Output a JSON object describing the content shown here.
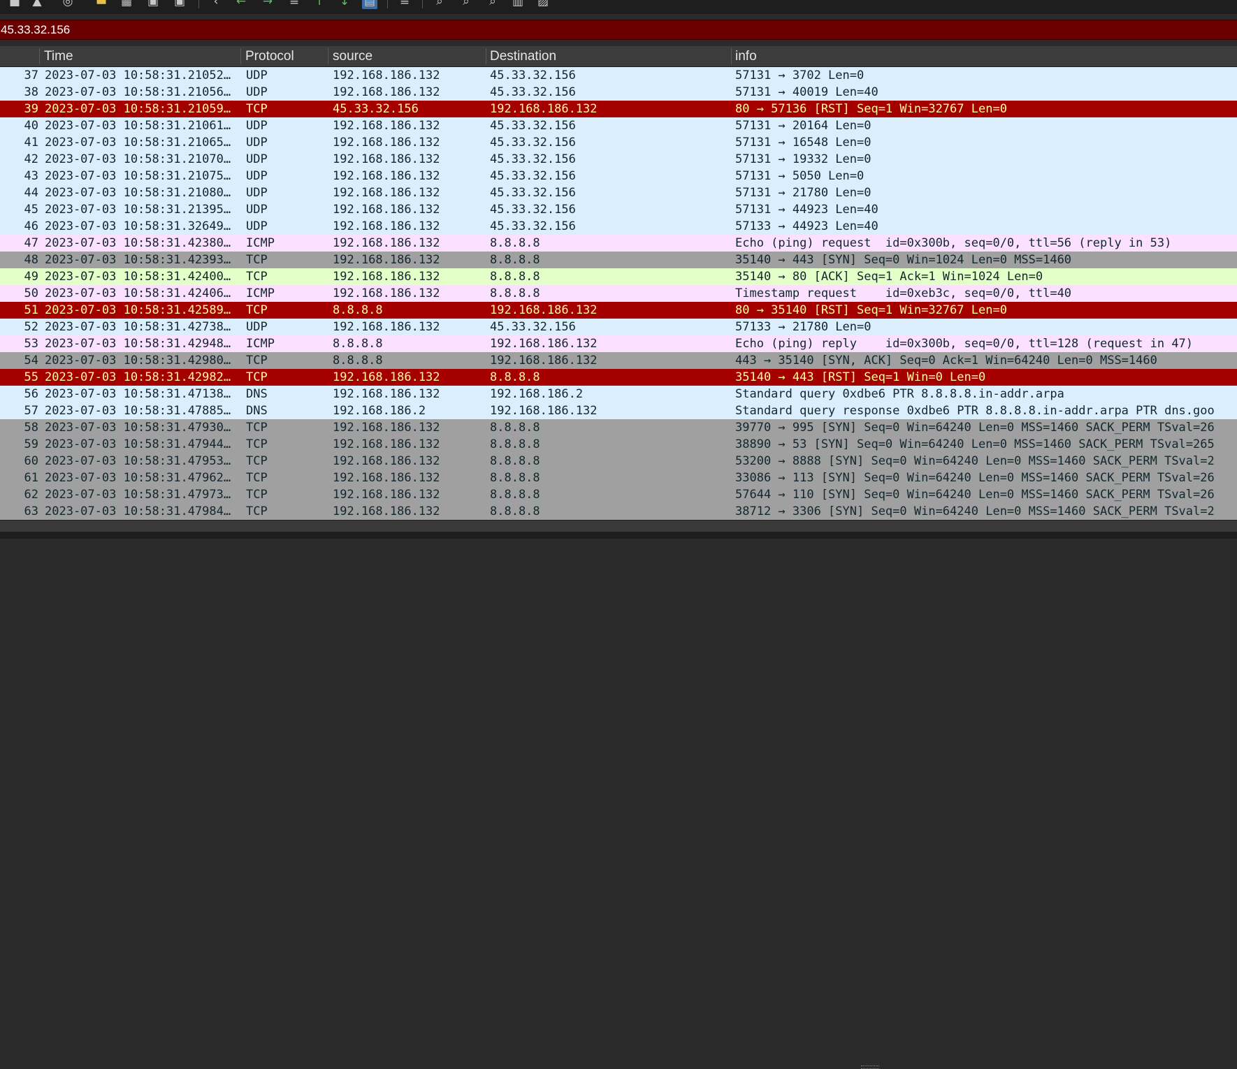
{
  "toolbar": {
    "icons": [
      "stop-icon",
      "restart-icon",
      "options-icon",
      "open-folder-icon",
      "save-file-icon",
      "close-file-icon",
      "reload-icon",
      "go-back-icon",
      "go-forward-icon",
      "go-to-packet-icon",
      "first-packet-icon",
      "last-packet-icon",
      "autoscroll-icon",
      "colorize-icon",
      "zoom-in-icon",
      "zoom-out-icon",
      "normal-size-icon",
      "resize-columns-icon",
      "expand-icon"
    ]
  },
  "filter": {
    "value": "45.33.32.156"
  },
  "columns": {
    "no": "",
    "time": "Time",
    "protocol": "Protocol",
    "source": "source",
    "destination": "Destination",
    "info": "info"
  },
  "colors": {
    "udp": "#daeefd",
    "icmp": "#fce0ff",
    "tcp_ack": "#e4ffc7",
    "tcp_syn": "#a0a0a0",
    "rst_bg": "#a40000",
    "rst_fg": "#fffc9c",
    "filter_bg": "#6b0000"
  },
  "packets": [
    {
      "no": "37",
      "time": "2023-07-03 10:58:31.21052…",
      "protocol": "UDP",
      "source": "192.168.186.132",
      "destination": "45.33.32.156",
      "info": "57131 → 3702 Len=0",
      "style": "udp"
    },
    {
      "no": "38",
      "time": "2023-07-03 10:58:31.21056…",
      "protocol": "UDP",
      "source": "192.168.186.132",
      "destination": "45.33.32.156",
      "info": "57131 → 40019 Len=40",
      "style": "udp"
    },
    {
      "no": "39",
      "time": "2023-07-03 10:58:31.21059…",
      "protocol": "TCP",
      "source": "45.33.32.156",
      "destination": "192.168.186.132",
      "info": "80 → 57136 [RST] Seq=1 Win=32767 Len=0",
      "style": "rst"
    },
    {
      "no": "40",
      "time": "2023-07-03 10:58:31.21061…",
      "protocol": "UDP",
      "source": "192.168.186.132",
      "destination": "45.33.32.156",
      "info": "57131 → 20164 Len=0",
      "style": "udp"
    },
    {
      "no": "41",
      "time": "2023-07-03 10:58:31.21065…",
      "protocol": "UDP",
      "source": "192.168.186.132",
      "destination": "45.33.32.156",
      "info": "57131 → 16548 Len=0",
      "style": "udp"
    },
    {
      "no": "42",
      "time": "2023-07-03 10:58:31.21070…",
      "protocol": "UDP",
      "source": "192.168.186.132",
      "destination": "45.33.32.156",
      "info": "57131 → 19332 Len=0",
      "style": "udp"
    },
    {
      "no": "43",
      "time": "2023-07-03 10:58:31.21075…",
      "protocol": "UDP",
      "source": "192.168.186.132",
      "destination": "45.33.32.156",
      "info": "57131 → 5050 Len=0",
      "style": "udp"
    },
    {
      "no": "44",
      "time": "2023-07-03 10:58:31.21080…",
      "protocol": "UDP",
      "source": "192.168.186.132",
      "destination": "45.33.32.156",
      "info": "57131 → 21780 Len=0",
      "style": "udp"
    },
    {
      "no": "45",
      "time": "2023-07-03 10:58:31.21395…",
      "protocol": "UDP",
      "source": "192.168.186.132",
      "destination": "45.33.32.156",
      "info": "57131 → 44923 Len=40",
      "style": "udp"
    },
    {
      "no": "46",
      "time": "2023-07-03 10:58:31.32649…",
      "protocol": "UDP",
      "source": "192.168.186.132",
      "destination": "45.33.32.156",
      "info": "57133 → 44923 Len=40",
      "style": "udp"
    },
    {
      "no": "47",
      "time": "2023-07-03 10:58:31.42380…",
      "protocol": "ICMP",
      "source": "192.168.186.132",
      "destination": "8.8.8.8",
      "info": "Echo (ping) request  id=0x300b, seq=0/0, ttl=56 (reply in 53)",
      "style": "icmp"
    },
    {
      "no": "48",
      "time": "2023-07-03 10:58:31.42393…",
      "protocol": "TCP",
      "source": "192.168.186.132",
      "destination": "8.8.8.8",
      "info": "35140 → 443 [SYN] Seq=0 Win=1024 Len=0 MSS=1460",
      "style": "tcp-syn"
    },
    {
      "no": "49",
      "time": "2023-07-03 10:58:31.42400…",
      "protocol": "TCP",
      "source": "192.168.186.132",
      "destination": "8.8.8.8",
      "info": "35140 → 80 [ACK] Seq=1 Ack=1 Win=1024 Len=0",
      "style": "tcp-ack"
    },
    {
      "no": "50",
      "time": "2023-07-03 10:58:31.42406…",
      "protocol": "ICMP",
      "source": "192.168.186.132",
      "destination": "8.8.8.8",
      "info": "Timestamp request    id=0xeb3c, seq=0/0, ttl=40",
      "style": "icmp"
    },
    {
      "no": "51",
      "time": "2023-07-03 10:58:31.42589…",
      "protocol": "TCP",
      "source": "8.8.8.8",
      "destination": "192.168.186.132",
      "info": "80 → 35140 [RST] Seq=1 Win=32767 Len=0",
      "style": "rst"
    },
    {
      "no": "52",
      "time": "2023-07-03 10:58:31.42738…",
      "protocol": "UDP",
      "source": "192.168.186.132",
      "destination": "45.33.32.156",
      "info": "57133 → 21780 Len=0",
      "style": "udp"
    },
    {
      "no": "53",
      "time": "2023-07-03 10:58:31.42948…",
      "protocol": "ICMP",
      "source": "8.8.8.8",
      "destination": "192.168.186.132",
      "info": "Echo (ping) reply    id=0x300b, seq=0/0, ttl=128 (request in 47)",
      "style": "icmp"
    },
    {
      "no": "54",
      "time": "2023-07-03 10:58:31.42980…",
      "protocol": "TCP",
      "source": "8.8.8.8",
      "destination": "192.168.186.132",
      "info": "443 → 35140 [SYN, ACK] Seq=0 Ack=1 Win=64240 Len=0 MSS=1460",
      "style": "tcp-syn"
    },
    {
      "no": "55",
      "time": "2023-07-03 10:58:31.42982…",
      "protocol": "TCP",
      "source": "192.168.186.132",
      "destination": "8.8.8.8",
      "info": "35140 → 443 [RST] Seq=1 Win=0 Len=0",
      "style": "rst"
    },
    {
      "no": "56",
      "time": "2023-07-03 10:58:31.47138…",
      "protocol": "DNS",
      "source": "192.168.186.132",
      "destination": "192.168.186.2",
      "info": "Standard query 0xdbe6 PTR 8.8.8.8.in-addr.arpa",
      "style": "dns"
    },
    {
      "no": "57",
      "time": "2023-07-03 10:58:31.47885…",
      "protocol": "DNS",
      "source": "192.168.186.2",
      "destination": "192.168.186.132",
      "info": "Standard query response 0xdbe6 PTR 8.8.8.8.in-addr.arpa PTR dns.goo",
      "style": "dns"
    },
    {
      "no": "58",
      "time": "2023-07-03 10:58:31.47930…",
      "protocol": "TCP",
      "source": "192.168.186.132",
      "destination": "8.8.8.8",
      "info": "39770 → 995 [SYN] Seq=0 Win=64240 Len=0 MSS=1460 SACK_PERM TSval=26",
      "style": "tcp-syn"
    },
    {
      "no": "59",
      "time": "2023-07-03 10:58:31.47944…",
      "protocol": "TCP",
      "source": "192.168.186.132",
      "destination": "8.8.8.8",
      "info": "38890 → 53 [SYN] Seq=0 Win=64240 Len=0 MSS=1460 SACK_PERM TSval=265",
      "style": "tcp-syn"
    },
    {
      "no": "60",
      "time": "2023-07-03 10:58:31.47953…",
      "protocol": "TCP",
      "source": "192.168.186.132",
      "destination": "8.8.8.8",
      "info": "53200 → 8888 [SYN] Seq=0 Win=64240 Len=0 MSS=1460 SACK_PERM TSval=2",
      "style": "tcp-syn"
    },
    {
      "no": "61",
      "time": "2023-07-03 10:58:31.47962…",
      "protocol": "TCP",
      "source": "192.168.186.132",
      "destination": "8.8.8.8",
      "info": "33086 → 113 [SYN] Seq=0 Win=64240 Len=0 MSS=1460 SACK_PERM TSval=26",
      "style": "tcp-syn"
    },
    {
      "no": "62",
      "time": "2023-07-03 10:58:31.47973…",
      "protocol": "TCP",
      "source": "192.168.186.132",
      "destination": "8.8.8.8",
      "info": "57644 → 110 [SYN] Seq=0 Win=64240 Len=0 MSS=1460 SACK_PERM TSval=26",
      "style": "tcp-syn"
    },
    {
      "no": "63",
      "time": "2023-07-03 10:58:31.47984…",
      "protocol": "TCP",
      "source": "192.168.186.132",
      "destination": "8.8.8.8",
      "info": "38712 → 3306 [SYN] Seq=0 Win=64240 Len=0 MSS=1460 SACK_PERM TSval=2",
      "style": "tcp-syn"
    }
  ]
}
